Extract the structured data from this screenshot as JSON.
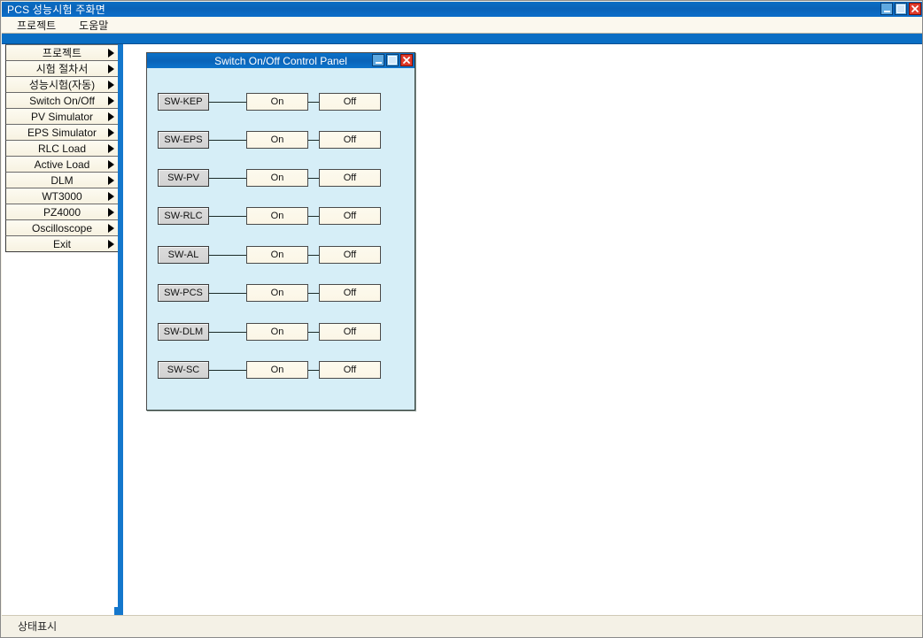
{
  "window": {
    "title": "PCS 성능시험 주화면",
    "controls": {
      "minimize": "minimize-icon",
      "maximize": "maximize-icon",
      "close": "close-icon"
    }
  },
  "menubar": {
    "items": [
      {
        "label": "프로젝트"
      },
      {
        "label": "도움말"
      }
    ]
  },
  "sidebar": {
    "items": [
      {
        "label": "프로젝트",
        "arrow": "triangle-right-icon"
      },
      {
        "label": "시험 절차서",
        "arrow": "triangle-right-icon"
      },
      {
        "label": "성능시험(자동)",
        "arrow": "triangle-right-icon"
      },
      {
        "label": "Switch On/Off",
        "arrow": "triangle-right-icon"
      },
      {
        "label": "PV Simulator",
        "arrow": "triangle-right-icon"
      },
      {
        "label": "EPS Simulator",
        "arrow": "triangle-right-icon"
      },
      {
        "label": "RLC Load",
        "arrow": "triangle-right-icon"
      },
      {
        "label": "Active Load",
        "arrow": "triangle-right-icon"
      },
      {
        "label": "DLM",
        "arrow": "triangle-right-icon"
      },
      {
        "label": "WT3000",
        "arrow": "triangle-right-icon"
      },
      {
        "label": "PZ4000",
        "arrow": "triangle-right-icon"
      },
      {
        "label": "Oscilloscope",
        "arrow": "triangle-right-icon"
      },
      {
        "label": "Exit",
        "arrow": "triangle-right-icon"
      }
    ]
  },
  "dialog": {
    "title": "Switch On/Off Control Panel",
    "controls": {
      "minimize": "minimize-icon",
      "maximize": "maximize-icon",
      "close": "close-icon"
    },
    "on_label": "On",
    "off_label": "Off",
    "switches": [
      {
        "name": "SW-KEP"
      },
      {
        "name": "SW-EPS"
      },
      {
        "name": "SW-PV"
      },
      {
        "name": "SW-RLC"
      },
      {
        "name": "SW-AL"
      },
      {
        "name": "SW-PCS"
      },
      {
        "name": "SW-DLM"
      },
      {
        "name": "SW-SC"
      }
    ]
  },
  "statusbar": {
    "text": "상태표시"
  },
  "colors": {
    "titlebar_blue": "#0a6ec4",
    "panel_cyan": "#d6eef7",
    "button_cream": "#fdfaee",
    "label_gray": "#d6d6d6",
    "close_red": "#e03a2a"
  }
}
